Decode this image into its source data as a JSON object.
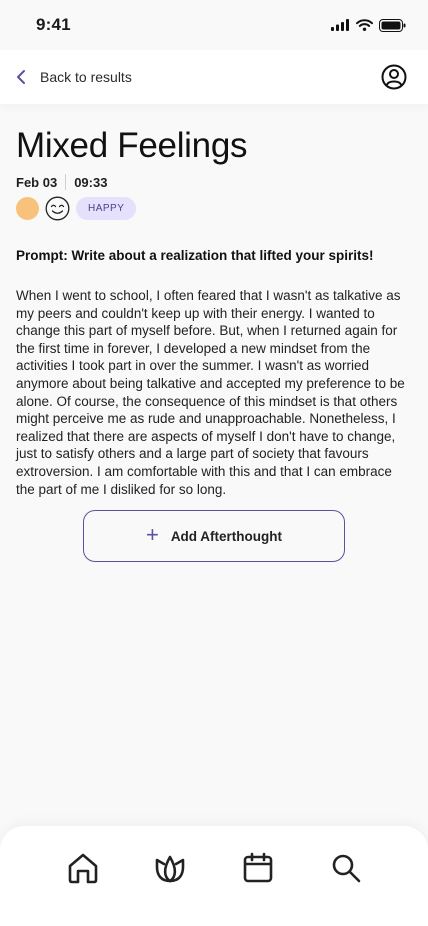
{
  "status_bar": {
    "time": "9:41"
  },
  "header": {
    "back_label": "Back to results"
  },
  "entry": {
    "title": "Mixed Feelings",
    "date": "Feb 03",
    "time": "09:33",
    "mood_label": "HAPPY",
    "prompt": "Prompt: Write about a realization that lifted your spirits!",
    "body": "When I went to school, I often feared that I wasn't as talkative as my peers and couldn't keep up with their energy. I wanted to change this part of myself before. But, when I returned again for the first time in forever, I developed a new mindset from the activities I took part in over the summer. I wasn't as worried anymore about being talkative and accepted my preference to be alone. Of course, the consequence of this mindset is that others might perceive me as rude and unapproachable. Nonetheless, I realized that there are aspects of myself I don't have to change, just to satisfy others and a large part of society that favours extroversion. I am comfortable with this and that I can embrace the part of me I disliked for so long."
  },
  "actions": {
    "add_afterthought_label": "Add Afterthought"
  },
  "colors": {
    "accent": "#5e509e",
    "mood_dot": "#f8c27c",
    "badge_bg": "#e5e0fb"
  },
  "icons": {
    "back": "chevron-left-icon",
    "profile": "user-circle-icon",
    "nav": [
      "home-icon",
      "lotus-icon",
      "calendar-icon",
      "search-icon"
    ]
  }
}
